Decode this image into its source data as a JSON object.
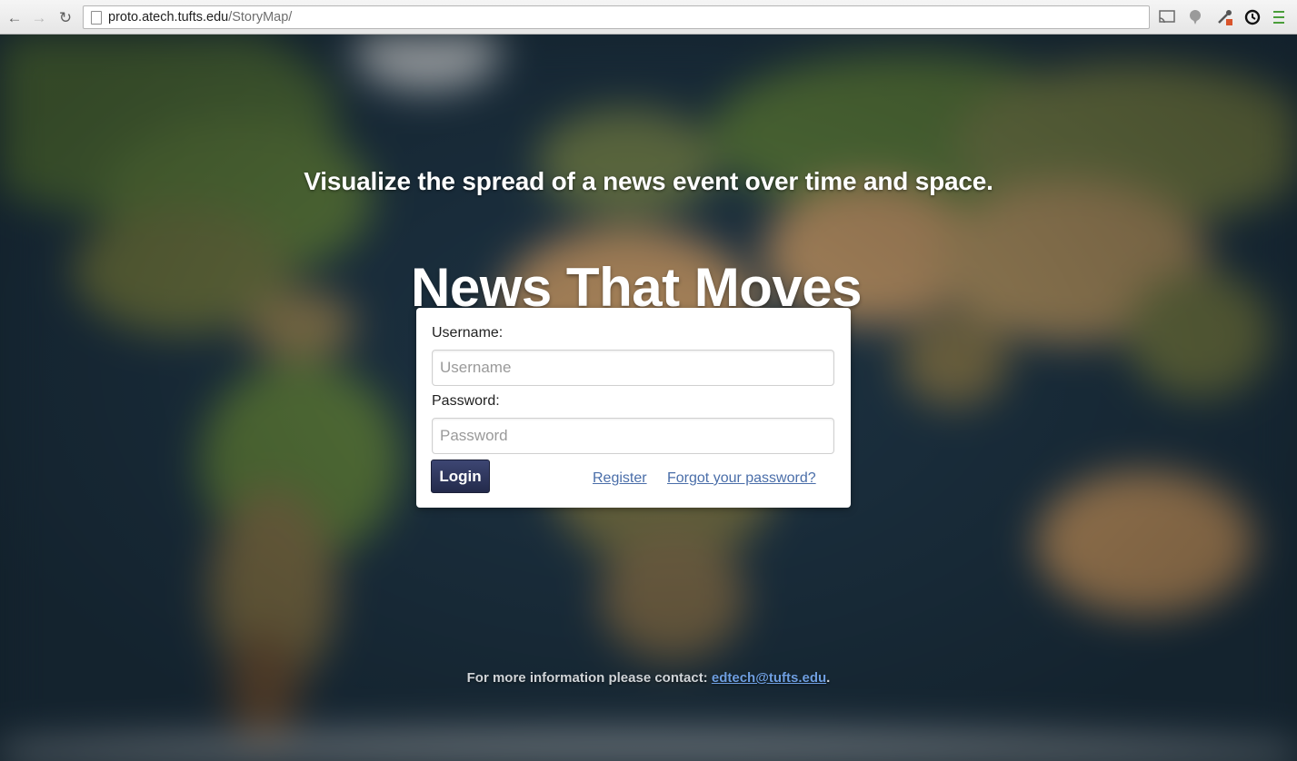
{
  "browser": {
    "url_host": "proto.atech.tufts.edu",
    "url_path": "/StoryMap/",
    "icons": [
      "back-icon",
      "forward-icon",
      "reload-icon",
      "page-icon",
      "cast-icon",
      "speech-bubble-icon",
      "eyedropper-icon",
      "sync-icon",
      "menu-icon"
    ]
  },
  "page": {
    "tagline": "Visualize the spread of a news event over time and space.",
    "title": "News That Moves"
  },
  "login": {
    "username_label": "Username:",
    "username_placeholder": "Username",
    "username_value": "",
    "password_label": "Password:",
    "password_placeholder": "Password",
    "password_value": "",
    "login_button": "Login",
    "register_link": "Register",
    "forgot_link": "Forgot your password?"
  },
  "footer": {
    "text": "For more information please contact: ",
    "email": "edtech@tufts.edu",
    "suffix": "."
  },
  "colors": {
    "login_button": "#2b3256",
    "link": "#4a6ea9",
    "footer_link": "#6e9ee0"
  }
}
